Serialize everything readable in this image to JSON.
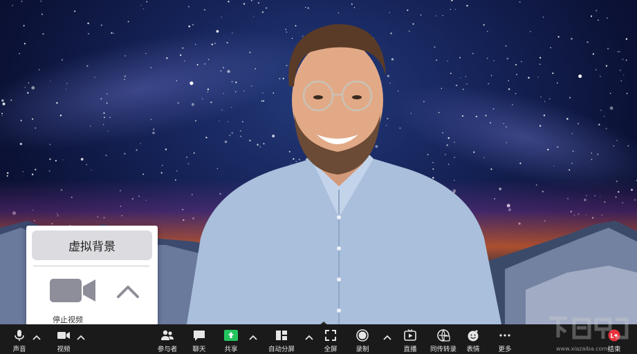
{
  "popup": {
    "virtual_background_label": "虚拟背景",
    "stop_video_label": "停止视频"
  },
  "toolbar": {
    "audio_label": "声音",
    "video_label": "视频",
    "participants_label": "参与者",
    "chat_label": "聊天",
    "share_label": "共享",
    "auto_split_label": "自动分屏",
    "fullscreen_label": "全屏",
    "record_label": "录制",
    "live_label": "直播",
    "transcribe_label": "同传转录",
    "reactions_label": "表情",
    "more_label": "更多",
    "end_label": "结束"
  },
  "watermark": {
    "site": "www.xiazaiba.com"
  },
  "colors": {
    "toolbar_bg": "#1a1a1a",
    "share_green": "#23c45e",
    "end_red": "#e8323c",
    "popup_bg": "#ffffff",
    "popup_button": "#dcdce0",
    "camera_icon": "#8e8e9a"
  },
  "icons": {
    "audio": "microphone-icon",
    "video": "video-camera-icon",
    "participants": "people-icon",
    "chat": "chat-bubble-icon",
    "share": "share-screen-icon",
    "auto_split": "split-layout-icon",
    "fullscreen": "fullscreen-icon",
    "record": "record-icon",
    "live": "live-play-icon",
    "transcribe": "transcribe-icon",
    "reactions": "smiley-icon",
    "more": "ellipsis-icon",
    "end": "end-call-icon"
  }
}
